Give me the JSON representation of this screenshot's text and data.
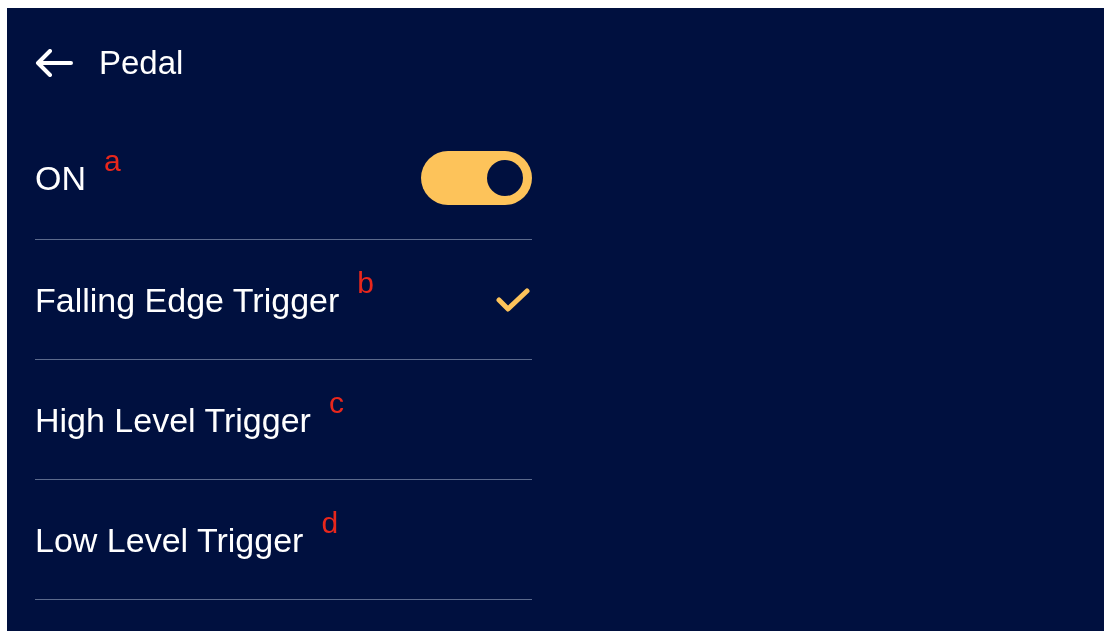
{
  "header": {
    "title": "Pedal"
  },
  "power": {
    "label": "ON",
    "annotation": "a",
    "on": true
  },
  "options": [
    {
      "label": "Falling Edge Trigger",
      "annotation": "b",
      "selected": true
    },
    {
      "label": "High Level Trigger",
      "annotation": "c",
      "selected": false
    },
    {
      "label": "Low Level Trigger",
      "annotation": "d",
      "selected": false
    }
  ]
}
